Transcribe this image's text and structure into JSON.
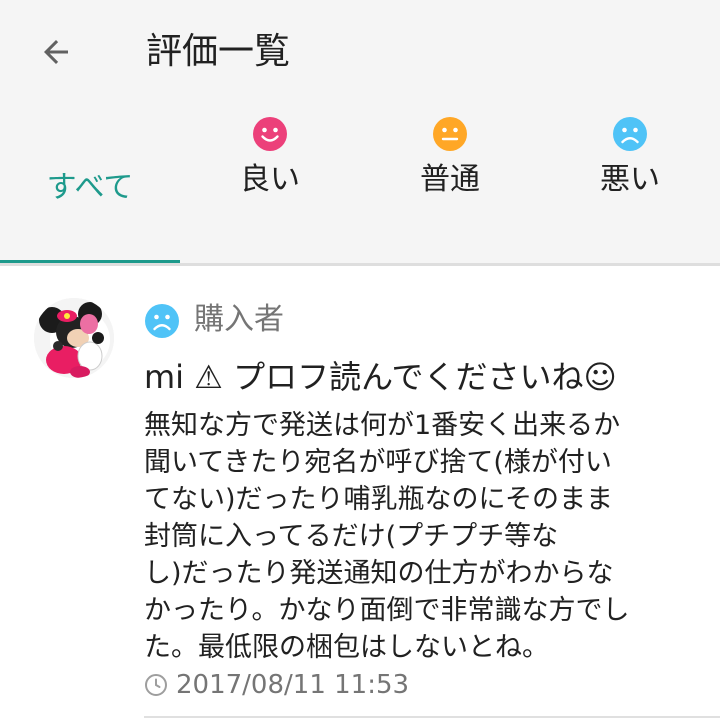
{
  "header": {
    "title": "評価一覧",
    "back_icon": "arrow-left-icon"
  },
  "tabs": [
    {
      "label": "すべて",
      "selected": true
    },
    {
      "label": "良い",
      "icon": "smile-face-icon",
      "color": "#ec407a"
    },
    {
      "label": "普通",
      "icon": "neutral-face-icon",
      "color": "#ffa726"
    },
    {
      "label": "悪い",
      "icon": "sad-face-icon",
      "color": "#4fc3f7"
    }
  ],
  "colors": {
    "accent": "#1e9a8c",
    "header_bg": "#f5f5f5",
    "secondary_text": "#757575"
  },
  "review": {
    "rating_icon": "sad-face-icon",
    "role": "購入者",
    "title": "mi ⚠ プロフ読んでくださいね☺",
    "body": "無知な方で発送は何が1番安く出来るか\n聞いてきたり宛名が呼び捨て(様が付い\nてない)だったり哺乳瓶なのにそのまま\n封筒に入ってるだけ(プチプチ等な\nし)だったり発送通知の仕方がわからな\nかったり。かなり面倒で非常識な方でし\nた。最低限の梱包はしないとね。",
    "timestamp": "2017/08/11 11:53"
  }
}
